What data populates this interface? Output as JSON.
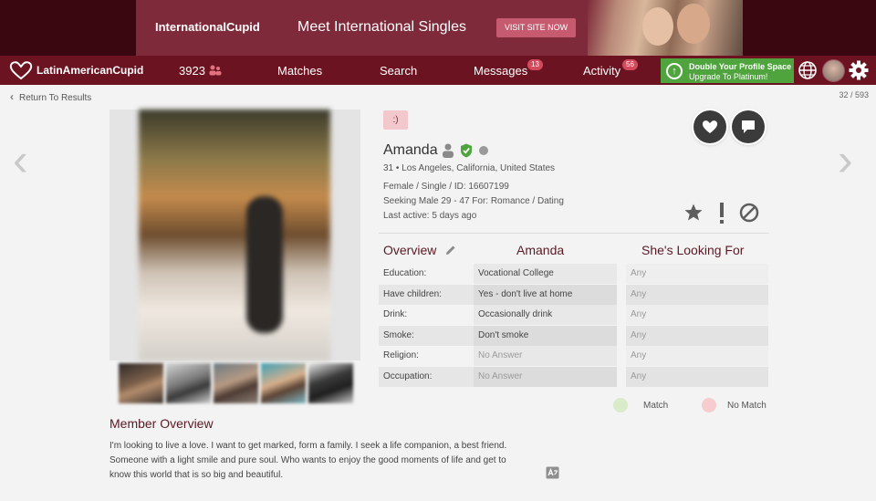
{
  "ad": {
    "brand": "InternationalCupid",
    "title": "Meet International Singles",
    "button": "VISIT SITE NOW"
  },
  "nav": {
    "logo": "LatinAmericanCupid",
    "likes_count": "3923",
    "matches": "Matches",
    "search": "Search",
    "messages": "Messages",
    "messages_badge": "13",
    "activity": "Activity",
    "activity_badge": "56",
    "upgrade_line1": "Double Your Profile Space",
    "upgrade_line2": "Upgrade To Platinum!"
  },
  "subbar": {
    "back": "Return To Results",
    "counter": "32 / 593"
  },
  "profile": {
    "chip": ":)",
    "name": "Amanda",
    "age_location": "31 • Los Angeles, California, United States",
    "details": "Female / Single / ID: 16607199",
    "seeking": "Seeking Male 29 - 47 For: Romance / Dating",
    "last_active": "Last active: 5 days ago"
  },
  "overview": {
    "col1": "Overview",
    "col2": "Amanda",
    "col3": "She's Looking For",
    "rows": [
      {
        "label": "Education:",
        "value": "Vocational College",
        "looking": "Any",
        "muted": false
      },
      {
        "label": "Have children:",
        "value": "Yes - don't live at home",
        "looking": "Any",
        "muted": false
      },
      {
        "label": "Drink:",
        "value": "Occasionally drink",
        "looking": "Any",
        "muted": false
      },
      {
        "label": "Smoke:",
        "value": "Don't smoke",
        "looking": "Any",
        "muted": false
      },
      {
        "label": "Religion:",
        "value": "No Answer",
        "looking": "Any",
        "muted": true
      },
      {
        "label": "Occupation:",
        "value": "No Answer",
        "looking": "Any",
        "muted": true
      }
    ],
    "legend_match": "Match",
    "legend_nomatch": "No Match",
    "match_color": "#d9ebc9",
    "nomatch_color": "#f6cccf"
  },
  "member_overview": {
    "title": "Member Overview",
    "text": "I'm looking to live a love. I want to get marked, form a family. I seek a life companion, a best friend. Someone with a light smile and pure soul. Who wants to enjoy the good moments of life and get to know this world that is so big and beautiful."
  },
  "colors": {
    "brand": "#6b1320",
    "upgrade": "#4fa43e",
    "heading": "#5a1a24"
  }
}
